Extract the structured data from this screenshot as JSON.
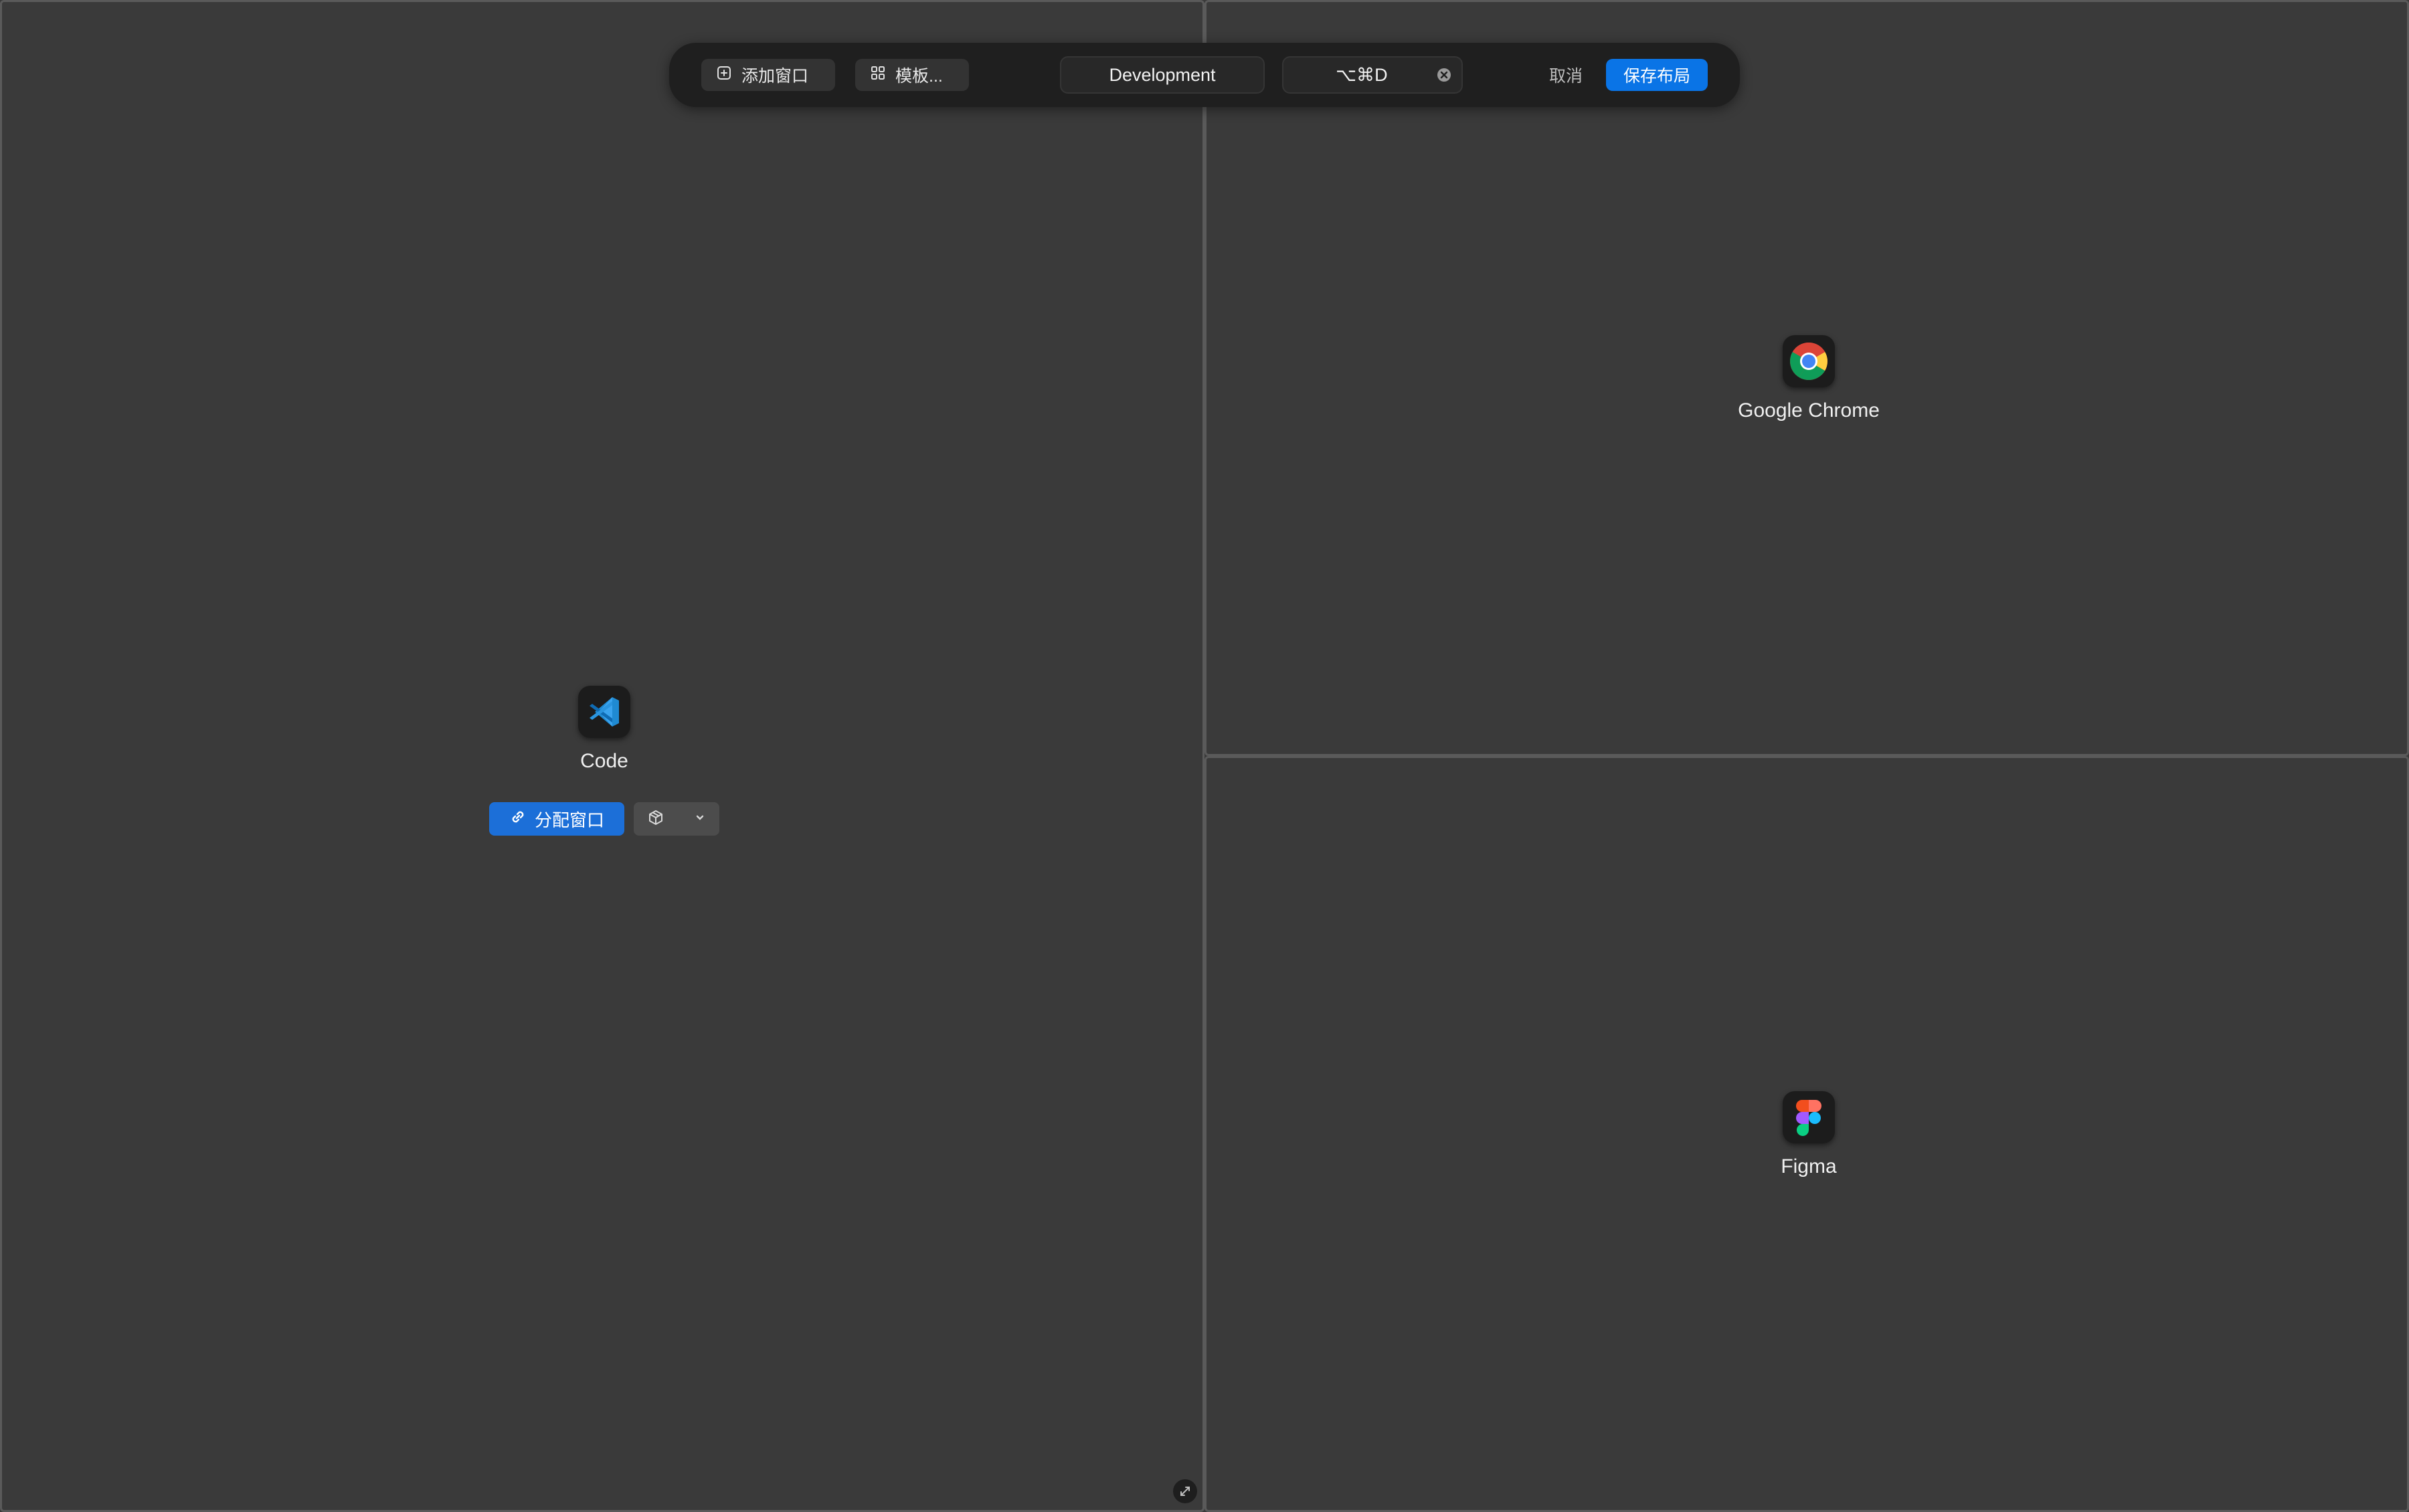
{
  "toolbar": {
    "add_window_label": "添加窗口",
    "templates_label": "模板...",
    "layout_name": "Development",
    "shortcut": "⌥⌘D",
    "cancel_label": "取消",
    "save_label": "保存布局"
  },
  "panes": {
    "left": {
      "app_name": "Code",
      "icon": "vscode-icon",
      "assign_label": "分配窗口"
    },
    "top_right": {
      "app_name": "Google Chrome",
      "icon": "chrome-icon"
    },
    "bottom_right": {
      "app_name": "Figma",
      "icon": "figma-icon"
    }
  },
  "colors": {
    "accent": "#0a74e6",
    "pane_bg": "#3a3a3a",
    "toolbar_bg": "#1f1f1f"
  }
}
